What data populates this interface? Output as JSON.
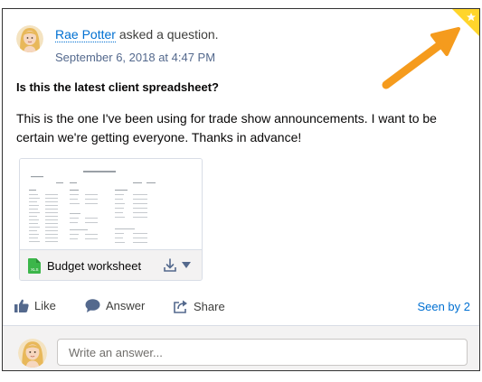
{
  "post": {
    "author": "Rae Potter",
    "action_text": "asked a question.",
    "timestamp": "September 6, 2018 at 4:47 PM",
    "title": "Is this the latest client spreadsheet?",
    "body": "This is the one I've been using for trade show announcements. I want to be certain we're getting everyone. Thanks in advance!"
  },
  "attachment": {
    "file_name": "Budget worksheet",
    "file_type": "excel-icon",
    "preview_title": "Budget Worksheet"
  },
  "actions": {
    "like": "Like",
    "answer": "Answer",
    "share": "Share",
    "seen_by": "Seen by 2"
  },
  "composer": {
    "placeholder": "Write an answer..."
  },
  "colors": {
    "link": "#0070d2",
    "arrow": "#f59b1d",
    "flag": "#ffd52b",
    "excel": "#3cb64a"
  }
}
